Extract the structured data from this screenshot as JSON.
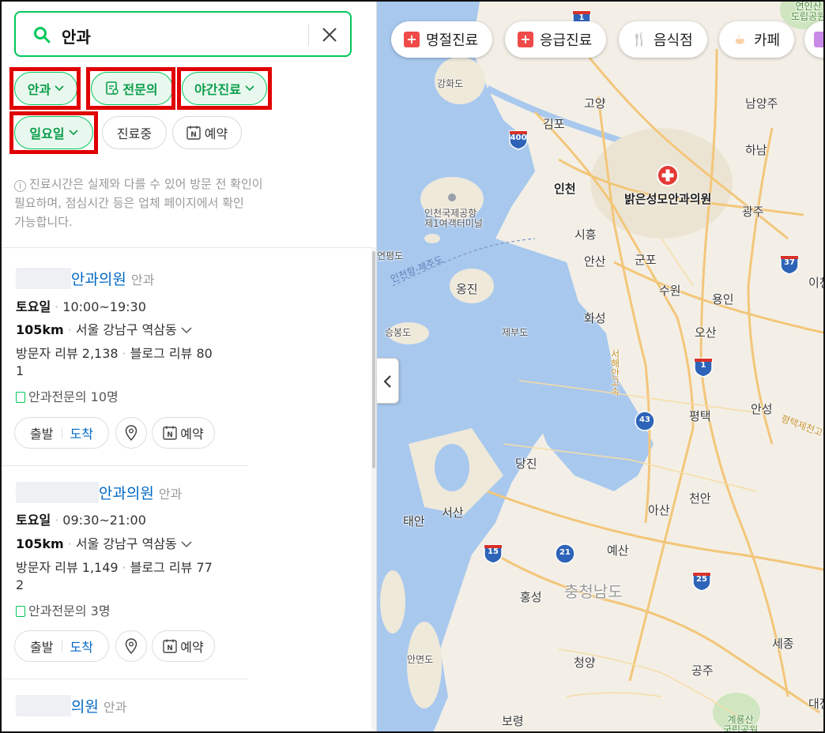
{
  "search": {
    "query": "안과"
  },
  "filters": [
    {
      "label": "안과",
      "selected": true,
      "dropdown": true
    },
    {
      "label": "전문의",
      "selected": true,
      "dropdown": false
    },
    {
      "label": "야간진료",
      "selected": true,
      "dropdown": true
    },
    {
      "label": "일요일",
      "selected": true,
      "dropdown": true
    },
    {
      "label": "진료중",
      "selected": false,
      "dropdown": false
    },
    {
      "label": "예약",
      "selected": false,
      "dropdown": false
    }
  ],
  "notice": {
    "line1": "진료시간은 실제와 다를 수 있어 방문 전 확인이",
    "line2": "필요하며, 점심시간 등은 업체 페이지에서 확인",
    "line3": "가능합니다."
  },
  "results": [
    {
      "name_visible": "안과의원",
      "category": "안과",
      "day": "토요일",
      "hours": "10:00~19:30",
      "distance": "105km",
      "address": "서울 강남구 역삼동",
      "visitor_reviews_line1": "방문자 리뷰 2,138",
      "blog_reviews_line1": "블로그 리뷰 80",
      "reviews_wrap": "1",
      "specialists": "안과전문의 10명"
    },
    {
      "name_visible": "안과의원",
      "category": "안과",
      "day": "토요일",
      "hours": "09:30~21:00",
      "distance": "105km",
      "address": "서울 강남구 역삼동",
      "visitor_reviews_line1": "방문자 리뷰 1,149",
      "blog_reviews_line1": "블로그 리뷰 77",
      "reviews_wrap": "2",
      "specialists": "안과전문의 3명"
    },
    {
      "name_visible": "의원",
      "category": "안과"
    }
  ],
  "actions": {
    "depart": "출발",
    "arrive": "도착",
    "reserve": "예약"
  },
  "map_chips": [
    {
      "label": "명절진료",
      "icon": "medical-cross-icon"
    },
    {
      "label": "응급진료",
      "icon": "medical-cross-icon"
    },
    {
      "label": "음식점",
      "icon": "fork-knife-icon"
    },
    {
      "label": "카페",
      "icon": "coffee-cup-icon"
    }
  ],
  "map": {
    "pin_label": "밝은성모안과의원",
    "places": {
      "gimpo": "김포",
      "incheon": "인천",
      "goyang": "고양",
      "namyangju": "남양주",
      "hanam": "하남",
      "gwangju": "광주",
      "siheung": "시흥",
      "ansan": "안산",
      "gunpo": "군포",
      "suwon": "수원",
      "yongin": "용인",
      "hwaseong": "화성",
      "osan": "오산",
      "pyeongtaek": "평택",
      "anseong": "안성",
      "dangjin": "당진",
      "asan": "아산",
      "cheonan": "천안",
      "seosan": "서산",
      "taean": "태안",
      "yesan": "예산",
      "hongseong": "홍성",
      "chungnam": "충청남도",
      "sejong": "세종",
      "cheongyang": "청양",
      "gongju": "공주",
      "boryeong": "보령",
      "anmyeondo": "안면도",
      "ongjin": "옹진",
      "ganghwado": "강화도",
      "jebudo": "제부도",
      "seungbongdo": "승봉도",
      "yeonpyeongdo": "연평도",
      "airport": "인천국제공항\n제1여객터미널",
      "route_water": "인천항-제주도",
      "expressway": "서해안고속",
      "daejeon_edge": "대전",
      "icheon_edge": "이천",
      "park": "계룡산\n국립공원",
      "park_edge": "연인산\n도립공원",
      "pyeongtaek_road": "평택제천고속"
    },
    "shields": [
      "1",
      "400",
      "37",
      "1",
      "43",
      "15",
      "21",
      "25"
    ]
  }
}
